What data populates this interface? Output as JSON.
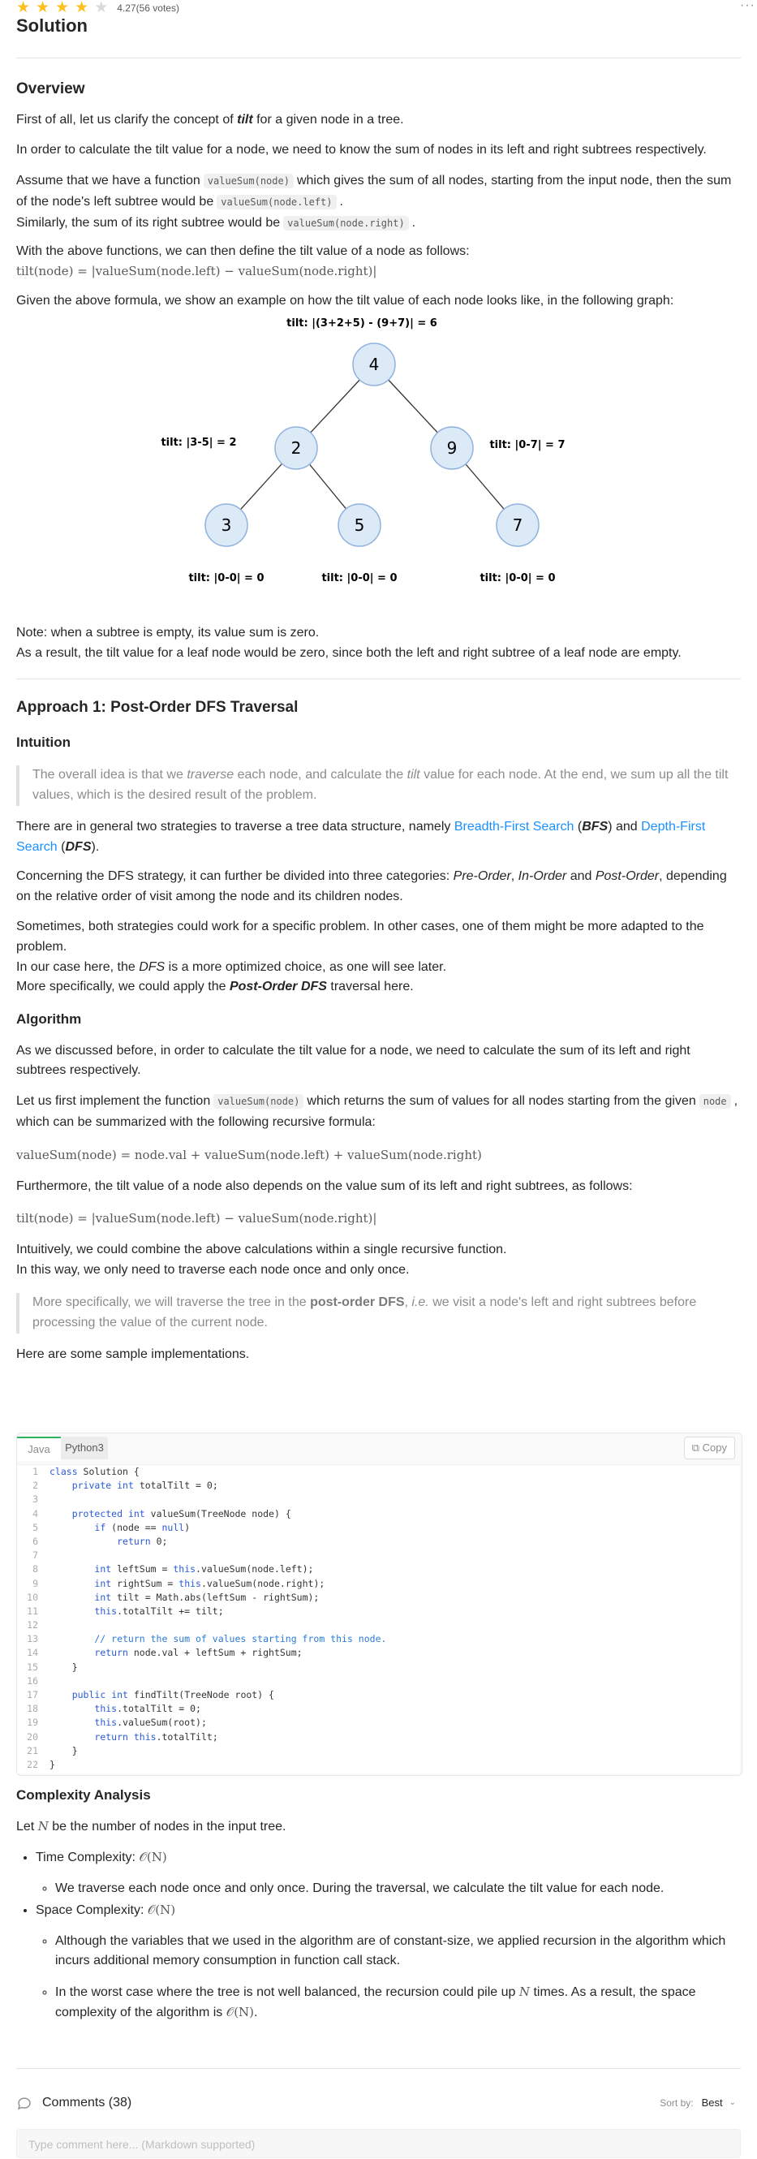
{
  "header": {
    "stars": [
      "★",
      "★",
      "★",
      "★",
      "★"
    ],
    "rating": "4.27",
    "votes": "(56 votes)",
    "more": "···",
    "title": "Solution"
  },
  "overview": {
    "heading": "Overview",
    "p1_a": "First of all, let us clarify the concept of ",
    "p1_b": "tilt",
    "p1_c": " for a given node in a tree.",
    "p2": "In order to calculate the tilt value for a node, we need to know the sum of nodes in its left and right subtrees respectively.",
    "p3_a": "Assume that we have a function",
    "p3_code1": "valueSum(node)",
    "p3_b": "which gives the sum of all nodes, starting from the input node, then the sum of the node's left subtree would be",
    "p3_code2": "valueSum(node.left)",
    "p3_c": ".",
    "p3_d": "Similarly, the sum of its right subtree would be",
    "p3_code3": "valueSum(node.right)",
    "p3_e": ".",
    "p4": "With the above functions, we can then define the tilt value of a node as follows:",
    "formula1": "tilt(node) = |valueSum(node.left) − valueSum(node.right)|",
    "p5": "Given the above formula, we show an example on how the tilt value of each node looks like, in the following graph:",
    "note": "Note: when a subtree is empty, its value sum is zero.",
    "p6": "As a result, the tilt value for a leaf node would be zero, since both the left and right subtree of a leaf node are empty."
  },
  "tree": {
    "nodes": [
      "4",
      "2",
      "9",
      "3",
      "5",
      "7"
    ],
    "labels": [
      "tilt: |(3+2+5) - (9+7)| = 6",
      "tilt: |3-5| = 2",
      "tilt: |0-7| = 7",
      "tilt: |0-0| = 0",
      "tilt: |0-0| = 0",
      "tilt: |0-0| = 0"
    ],
    "node_fill": "#dce9f7",
    "node_stroke": "#8fb2dd"
  },
  "approach": {
    "heading": "Approach 1: Post-Order DFS Traversal",
    "intuition": "Intuition",
    "quote1_a": "The overall idea is that we ",
    "quote1_b": "traverse",
    "quote1_c": " each node, and calculate the ",
    "quote1_d": "tilt",
    "quote1_e": " value for each node. At the end, we sum up all the tilt values, which is the desired result of the problem.",
    "s1_a": "There are in general two strategies to traverse a tree data structure, namely ",
    "s1_bfs_link": "Breadth-First Search",
    "s1_b": " (",
    "s1_bfs": "BFS",
    "s1_c": ") and ",
    "s1_dfs_link": "Depth-First Search",
    "s1_d": " (",
    "s1_dfs": "DFS",
    "s1_e": ").",
    "s2_a": "Concerning the DFS strategy, it can further be divided into three categories: ",
    "s2_pre": "Pre-Order",
    "s2_b": ", ",
    "s2_in": "In-Order",
    "s2_c": " and ",
    "s2_post": "Post-Order",
    "s2_d": ", depending on the relative order of visit among the node and its children nodes.",
    "s3": "Sometimes, both strategies could work for a specific problem. In other cases, one of them might be more adapted to the problem.",
    "s4_a": "In our case here, the ",
    "s4_dfs": "DFS",
    "s4_b": " is a more optimized choice, as one will see later.",
    "s5_a": "More specifically, we could apply the ",
    "s5_b": "Post-Order DFS",
    "s5_c": " traversal here.",
    "algorithm": "Algorithm",
    "a1": "As we discussed before, in order to calculate the tilt value for a node, we need to calculate the sum of its left and right subtrees respectively.",
    "a2_a": "Let us first implement the function",
    "a2_code1": "valueSum(node)",
    "a2_b": "which returns the sum of values for all nodes starting from the given",
    "a2_code2": "node",
    "a2_c": ", which can be summarized with the following recursive formula:",
    "formula2": "valueSum(node) = node.val + valueSum(node.left) + valueSum(node.right)",
    "a3": "Furthermore, the tilt value of a node also depends on the value sum of its left and right subtrees, as follows:",
    "formula3": "tilt(node) = |valueSum(node.left) − valueSum(node.right)|",
    "a4": "Intuitively, we could combine the above calculations within a single recursive function.",
    "a5": "In this way, we only need to traverse each node once and only once.",
    "quote2_a": "More specifically, we will traverse the tree in the ",
    "quote2_b": "post-order DFS",
    "quote2_c": ", ",
    "quote2_d": "i.e.",
    "quote2_e": " we visit a node's left and right subtrees before processing the value of the current node.",
    "a6": "Here are some sample implementations."
  },
  "code": {
    "tabs": [
      "Java",
      "Python3"
    ],
    "copy": "Copy",
    "lines": [
      "class Solution {",
      "    private int totalTilt = 0;",
      "",
      "    protected int valueSum(TreeNode node) {",
      "        if (node == null)",
      "            return 0;",
      "",
      "        int leftSum = this.valueSum(node.left);",
      "        int rightSum = this.valueSum(node.right);",
      "        int tilt = Math.abs(leftSum - rightSum);",
      "        this.totalTilt += tilt;",
      "",
      "        // return the sum of values starting from this node.",
      "        return node.val + leftSum + rightSum;",
      "    }",
      "",
      "    public int findTilt(TreeNode root) {",
      "        this.totalTilt = 0;",
      "        this.valueSum(root);",
      "        return this.totalTilt;",
      "    }",
      "}"
    ]
  },
  "complexity": {
    "heading": "Complexity Analysis",
    "let_a": "Let ",
    "let_n": "N",
    "let_b": " be the number of nodes in the input tree.",
    "time_label": "Time Complexity: ",
    "time_val": "𝒪(N)",
    "time_detail": "We traverse each node once and only once. During the traversal, we calculate the tilt value for each node.",
    "space_label": "Space Complexity: ",
    "space_val": "𝒪(N)",
    "space_d1": "Although the variables that we used in the algorithm are of constant-size, we applied recursion in the algorithm which incurs additional memory consumption in function call stack.",
    "space_d2_a": "In the worst case where the tree is not well balanced, the recursion could pile up ",
    "space_d2_n": "N",
    "space_d2_b": " times. As a result, the space complexity of the algorithm is ",
    "space_d2_val": "𝒪(N)",
    "space_d2_c": "."
  },
  "comments": {
    "label": "Comments (38)",
    "sort_label": "Sort by:",
    "sort_value": "Best",
    "placeholder": "Type comment here... (Markdown supported)"
  }
}
